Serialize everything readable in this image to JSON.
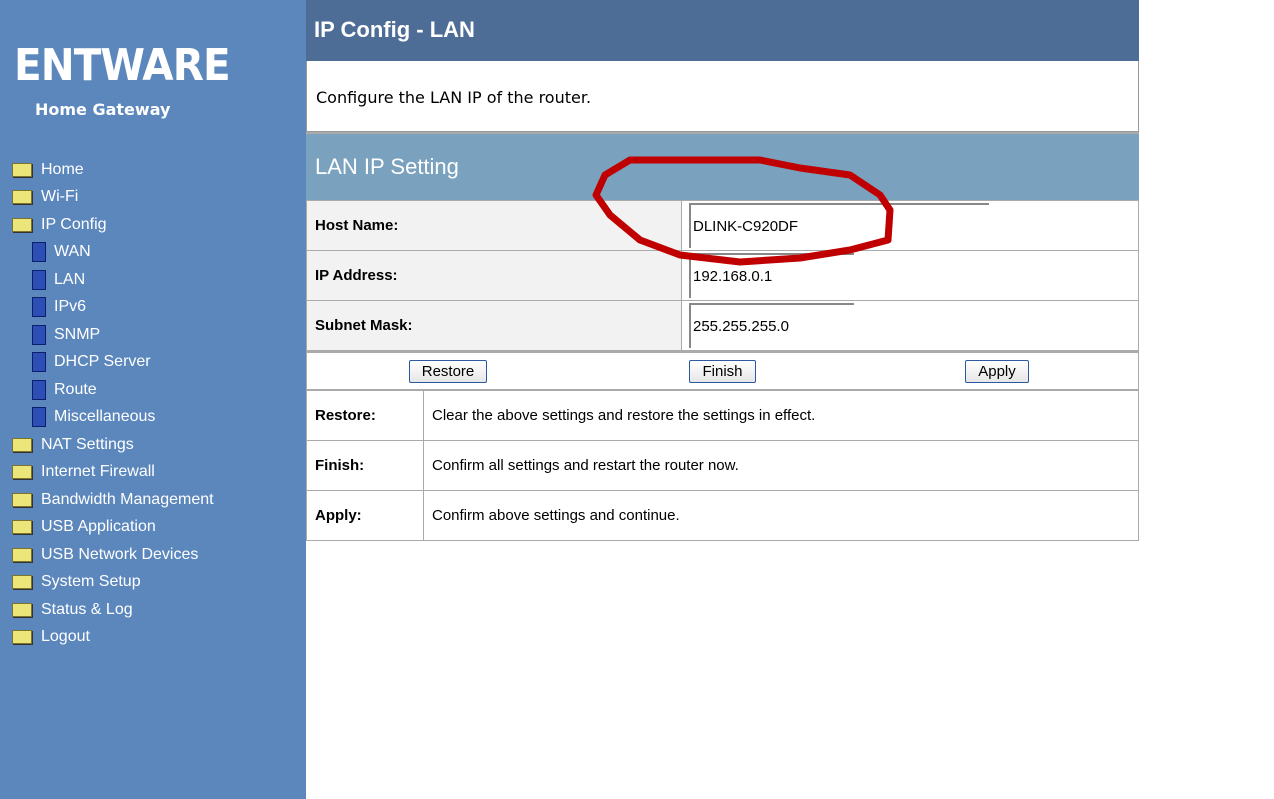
{
  "brand": {
    "logo": "ENTWARE",
    "subtitle": "Home Gateway"
  },
  "nav": [
    {
      "label": "Home",
      "type": "folder"
    },
    {
      "label": "Wi-Fi",
      "type": "folder"
    },
    {
      "label": "IP Config",
      "type": "folder-open"
    },
    {
      "label": "WAN",
      "type": "doc"
    },
    {
      "label": "LAN",
      "type": "doc"
    },
    {
      "label": "IPv6",
      "type": "doc"
    },
    {
      "label": "SNMP",
      "type": "doc"
    },
    {
      "label": "DHCP Server",
      "type": "doc"
    },
    {
      "label": "Route",
      "type": "doc"
    },
    {
      "label": "Miscellaneous",
      "type": "doc"
    },
    {
      "label": "NAT Settings",
      "type": "folder"
    },
    {
      "label": "Internet Firewall",
      "type": "folder"
    },
    {
      "label": "Bandwidth Management",
      "type": "folder"
    },
    {
      "label": "USB Application",
      "type": "folder"
    },
    {
      "label": "USB Network Devices",
      "type": "folder"
    },
    {
      "label": "System Setup",
      "type": "folder"
    },
    {
      "label": "Status & Log",
      "type": "folder"
    },
    {
      "label": "Logout",
      "type": "folder"
    }
  ],
  "page": {
    "title": "IP Config - LAN",
    "description": "Configure the LAN IP of the router.",
    "section": "LAN IP Setting"
  },
  "fields": {
    "host_label": "Host Name:",
    "host_value": "DLINK-C920DF",
    "ip_label": "IP Address:",
    "ip_value": "192.168.0.1",
    "mask_label": "Subnet Mask:",
    "mask_value": "255.255.255.0"
  },
  "buttons": {
    "restore": "Restore",
    "finish": "Finish",
    "apply": "Apply"
  },
  "help": [
    {
      "k": "Restore:",
      "v": "Clear the above settings and restore the settings in effect."
    },
    {
      "k": "Finish:",
      "v": "Confirm all settings and restart the router now."
    },
    {
      "k": "Apply:",
      "v": "Confirm above settings and continue."
    }
  ],
  "annotation_color": "#c00000"
}
